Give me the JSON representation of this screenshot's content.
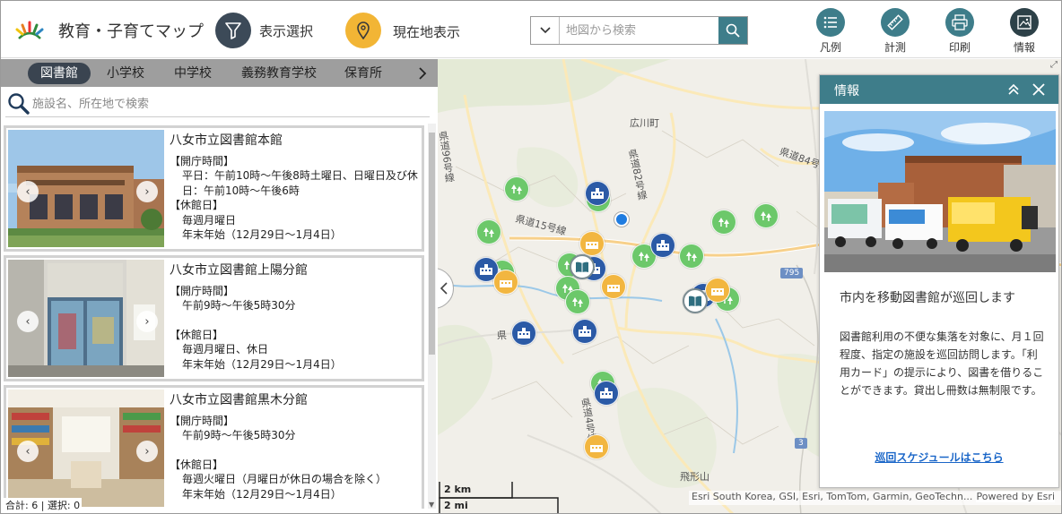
{
  "header": {
    "app_title": "教育・子育てマップ",
    "filter_label": "表示選択",
    "location_label": "現在地表示",
    "search_placeholder": "地図から検索",
    "tools": {
      "legend": "凡例",
      "measure": "計測",
      "print": "印刷",
      "info": "情報"
    }
  },
  "left_panel": {
    "tabs": [
      "図書館",
      "小学校",
      "中学校",
      "義務教育学校",
      "保育所"
    ],
    "search_placeholder": "施設名、所在地で検索",
    "cards": [
      {
        "name": "八女市立図書館本館",
        "hours_heading": "【開庁時間】",
        "hours_lines": [
          "平日：午前10時～午後8時土曜日、日曜日及び休日：午前10時～午後6時"
        ],
        "closed_heading": "【休館日】",
        "closed_lines": [
          "毎週月曜日",
          "年末年始（12月29日～1月4日）"
        ]
      },
      {
        "name": "八女市立図書館上陽分館",
        "hours_heading": "【開庁時間】",
        "hours_lines": [
          "午前9時～午後5時30分"
        ],
        "closed_heading": "【休館日】",
        "closed_lines": [
          "毎週月曜日、休日",
          "年末年始（12月29日～1月4日）"
        ]
      },
      {
        "name": "八女市立図書館黒木分館",
        "hours_heading": "【開庁時間】",
        "hours_lines": [
          "午前9時～午後5時30分"
        ],
        "closed_heading": "【休館日】",
        "closed_lines": [
          "毎週火曜日（月曜日が休日の場合を除く）",
          "年末年始（12月29日～1月4日）"
        ]
      }
    ],
    "status": "合計: 6 | 選択: 0"
  },
  "map": {
    "labels": {
      "hirokawa": "広川町",
      "route82": "県道82号線",
      "route15": "県道15号線",
      "route84": "県道84号線",
      "route4": "県道4号線",
      "route_left": "県道96号線",
      "hiyamayama": "飛形山",
      "road795": "795",
      "road3": "3",
      "road_ken": "県"
    },
    "scale": {
      "km": "2 km",
      "mi": "2 mi"
    },
    "attribution": "Esri South Korea, GSI, Esri, TomTom, Garmin, GeoTechn...",
    "powered_by": "Powered by Esri"
  },
  "info_panel": {
    "title": "情報",
    "headline": "市内を移動図書館が巡回します",
    "body": "図書館利用の不便な集落を対象に、月１回程度、指定の施設を巡回訪問します。「利用カード」の提示により、図書を借りることができます。貸出し冊数は無制限です。",
    "link": "巡回スケジュールはこちら"
  },
  "colors": {
    "accent": "#3e7d8a",
    "filter_button": "#3c4a58",
    "location_button": "#f2b535",
    "marker_park": "#6cc86a",
    "marker_school": "#2b5aa6",
    "marker_nursery": "#f2b640"
  }
}
